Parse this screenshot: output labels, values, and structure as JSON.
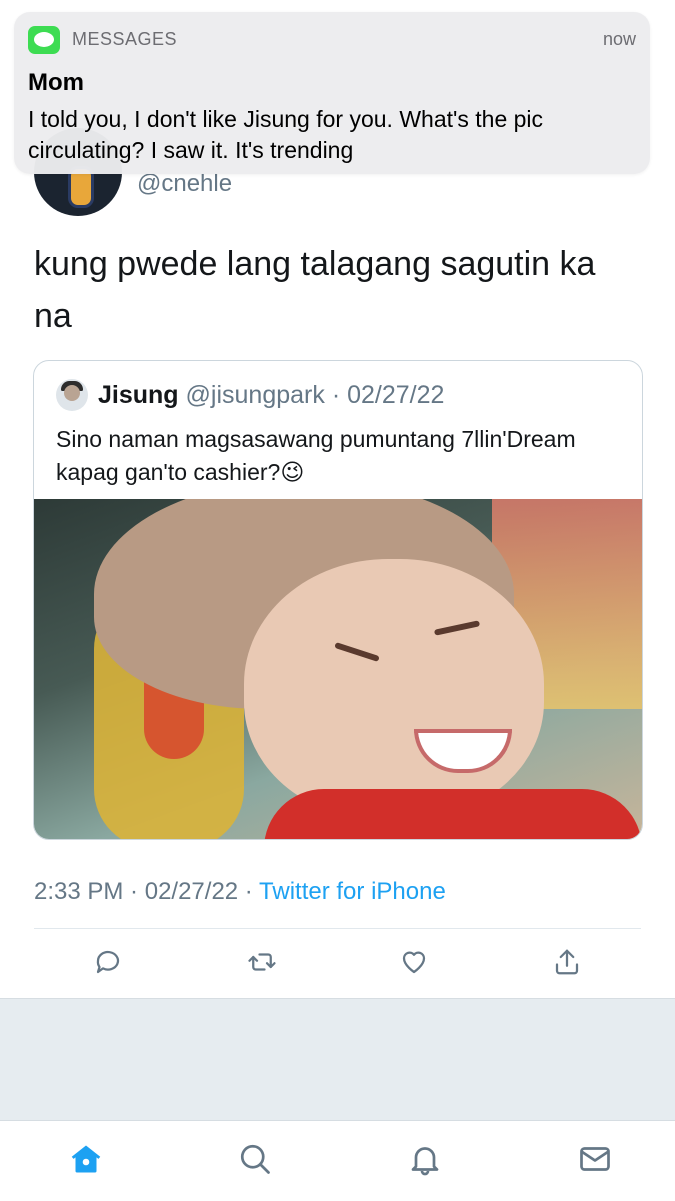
{
  "notification": {
    "app": "MESSAGES",
    "time": "now",
    "sender": "Mom",
    "body": "I told you, I don't like Jisung for you. What's the pic circulating? I saw it. It's trending",
    "icon": "messages-app-icon"
  },
  "tweet": {
    "handle": "@cnehle",
    "text": "kung pwede lang talagang sagutin ka na",
    "quote": {
      "name": "Jisung",
      "handle": "@jisungpark",
      "separator": " · ",
      "date": "02/27/22",
      "text": "Sino naman magsasawang pumuntang 7llin'Dream kapag gan'to cashier?😉"
    },
    "time": "2:33 PM",
    "sep": " · ",
    "date": "02/27/22",
    "client": "Twitter for iPhone",
    "actions": [
      "reply-icon",
      "retweet-icon",
      "like-icon",
      "share-icon"
    ]
  },
  "tabbar": {
    "items": [
      "home-icon",
      "search-icon",
      "notifications-icon",
      "messages-icon"
    ],
    "active_color": "#1da1f2",
    "inactive_color": "#657786"
  }
}
